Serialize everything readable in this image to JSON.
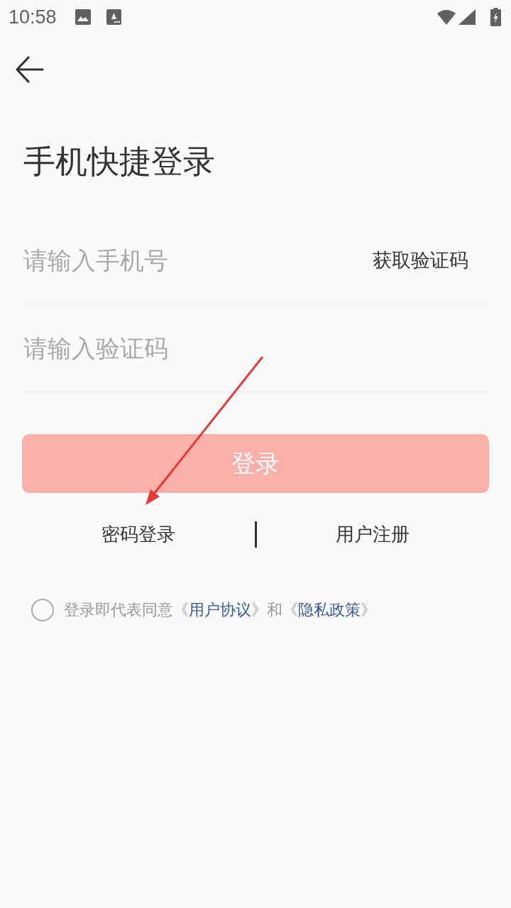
{
  "status_bar": {
    "time": "10:58"
  },
  "title": "手机快捷登录",
  "fields": [
    {
      "placeholder": "请输入手机号",
      "action": "获取验证码"
    },
    {
      "placeholder": "请输入验证码"
    }
  ],
  "login_button": {
    "label": "登录",
    "disabled": true
  },
  "links": [
    {
      "label": "密码登录"
    },
    {
      "label": "用户注册"
    }
  ],
  "agreement": {
    "checked": false,
    "segments": [
      {
        "kind": "plain",
        "text": "登录即代表同意《"
      },
      {
        "kind": "link",
        "text": "用户协议"
      },
      {
        "kind": "plain",
        "text": "》和《"
      },
      {
        "kind": "link",
        "text": "隐私政策"
      },
      {
        "kind": "plain",
        "text": "》"
      }
    ]
  }
}
